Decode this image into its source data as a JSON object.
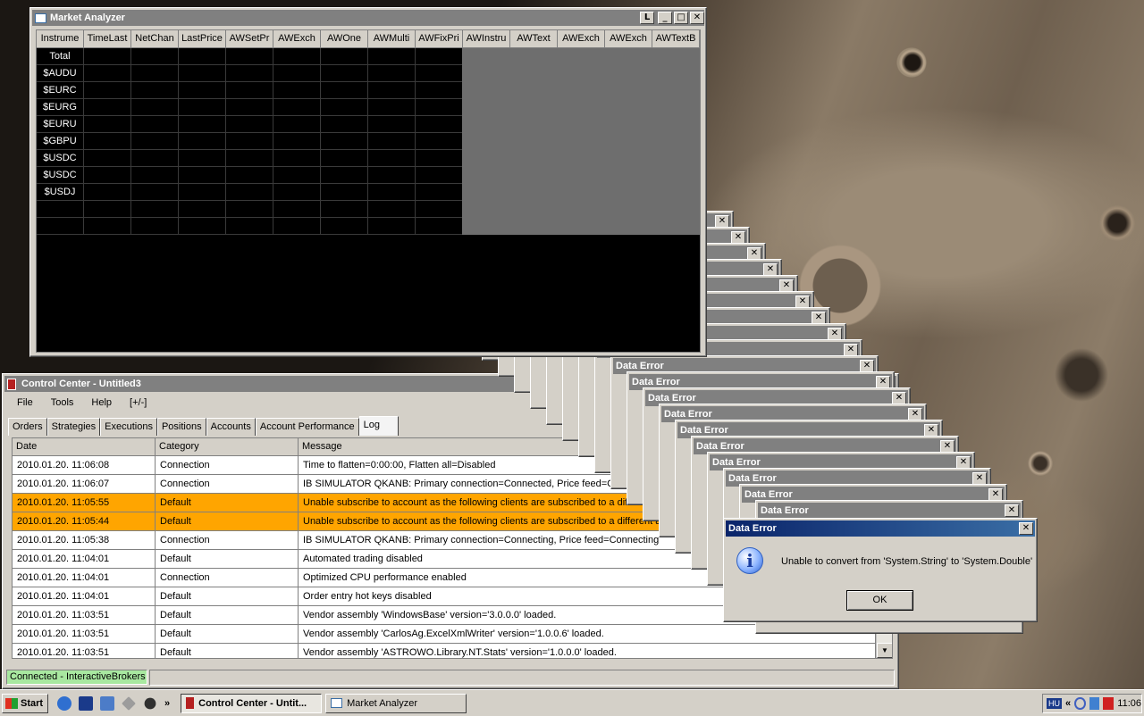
{
  "market_analyzer": {
    "title": "Market Analyzer",
    "title_buttons": [
      "L",
      "_",
      "□",
      "✕"
    ],
    "columns": [
      "Instrume",
      "TimeLast",
      "NetChan",
      "LastPrice",
      "AWSetPr",
      "AWExch",
      "AWOne",
      "AWMulti",
      "AWFixPri",
      "AWInstru",
      "AWText",
      "AWExch",
      "AWExch",
      "AWTextB"
    ],
    "rows": [
      "Total",
      "$AUDU",
      "$EURC",
      "$EURG",
      "$EURU",
      "$GBPU",
      "$USDC",
      "$USDC",
      "$USDJ",
      "",
      ""
    ]
  },
  "control_center": {
    "title": "Control Center - Untitled3",
    "menu": [
      "File",
      "Tools",
      "Help",
      "[+/-]"
    ],
    "tabs": [
      "Orders",
      "Strategies",
      "Executions",
      "Positions",
      "Accounts",
      "Account Performance",
      "Log"
    ],
    "active_tab": "Log",
    "log_columns": [
      "Date",
      "Category",
      "Message"
    ],
    "log_rows": [
      {
        "date": "2010.01.20. 11:06:08",
        "category": "Connection",
        "message": "Time to flatten=0:00:00, Flatten all=Disabled",
        "highlight": false
      },
      {
        "date": "2010.01.20. 11:06:07",
        "category": "Connection",
        "message": "IB SIMULATOR QKANB: Primary connection=Connected, Price feed=Connected",
        "highlight": false
      },
      {
        "date": "2010.01.20. 11:05:55",
        "category": "Default",
        "message": "Unable subscribe to account as the following clients are subscribed to a different account",
        "highlight": true
      },
      {
        "date": "2010.01.20. 11:05:44",
        "category": "Default",
        "message": "Unable subscribe to account as the following clients are subscribed to a different account",
        "highlight": true
      },
      {
        "date": "2010.01.20. 11:05:38",
        "category": "Connection",
        "message": "IB SIMULATOR QKANB: Primary connection=Connecting, Price feed=Connecting",
        "highlight": false
      },
      {
        "date": "2010.01.20. 11:04:01",
        "category": "Default",
        "message": "Automated trading disabled",
        "highlight": false
      },
      {
        "date": "2010.01.20. 11:04:01",
        "category": "Connection",
        "message": "Optimized CPU performance enabled",
        "highlight": false
      },
      {
        "date": "2010.01.20. 11:04:01",
        "category": "Default",
        "message": "Order entry hot keys disabled",
        "highlight": false
      },
      {
        "date": "2010.01.20. 11:03:51",
        "category": "Default",
        "message": "Vendor assembly 'WindowsBase' version='3.0.0.0' loaded.",
        "highlight": false
      },
      {
        "date": "2010.01.20. 11:03:51",
        "category": "Default",
        "message": "Vendor assembly 'CarlosAg.ExcelXmlWriter' version='1.0.0.6' loaded.",
        "highlight": false
      },
      {
        "date": "2010.01.20. 11:03:51",
        "category": "Default",
        "message": "Vendor assembly 'ASTROWO.Library.NT.Stats' version='1.0.0.0' loaded.",
        "highlight": false
      }
    ],
    "status": "Connected - InteractiveBrokers",
    "highlight_color": "#ffa500",
    "status_color": "#a8e8a0"
  },
  "error_stack": {
    "titles": [
      "",
      "",
      "",
      "",
      "",
      "",
      "",
      "",
      "",
      "Data Error",
      "Data Error",
      "Data Error",
      "Data Error",
      "Data Error",
      "Data Error",
      "Data Error",
      "Data Error",
      "Data Error",
      "Data Error"
    ]
  },
  "error_dialog": {
    "title": "Data Error",
    "message": "Unable to convert from 'System.String' to 'System.Double'",
    "ok_label": "OK",
    "icon": "information-icon"
  },
  "taskbar": {
    "start_label": "Start",
    "chevron": "»",
    "tasks": [
      {
        "label": "Control Center - Untit...",
        "active": true,
        "icon": "control-center-icon"
      },
      {
        "label": "Market Analyzer",
        "active": false,
        "icon": "market-analyzer-icon"
      }
    ],
    "tray_lang": "HU",
    "tray_chevron": "«",
    "clock": "11:06"
  }
}
